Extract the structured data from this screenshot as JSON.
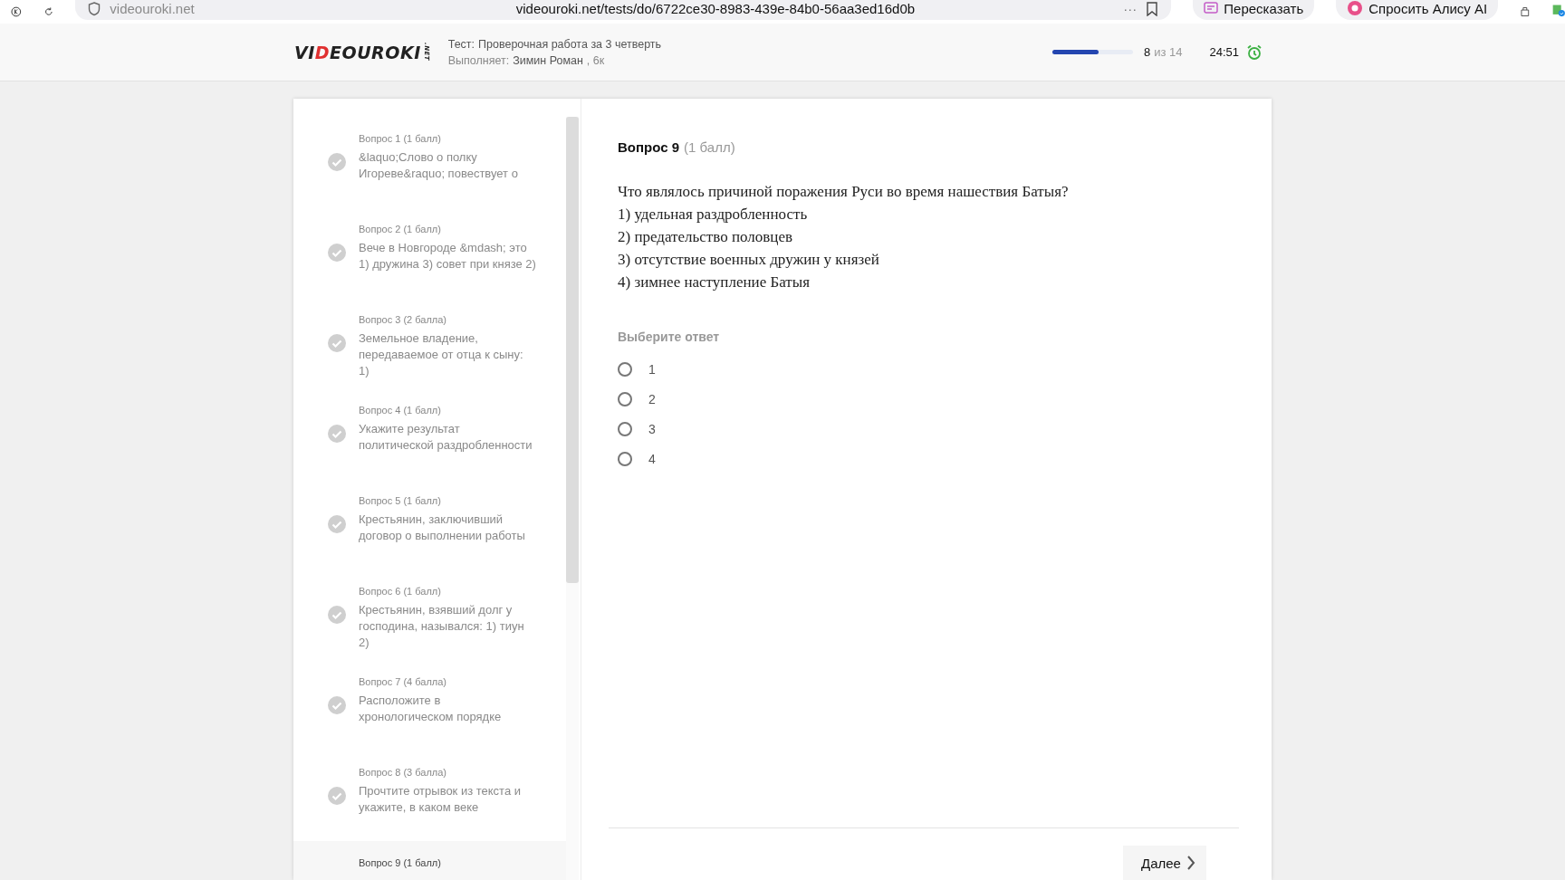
{
  "browser": {
    "site_label": "videouroki.net",
    "url": "videouroki.net/tests/do/6722ce30-8983-439e-84b0-56aa3ed16d0b",
    "more": "···",
    "buttons": [
      "Пересказать",
      "Спросить Алису AI"
    ]
  },
  "header": {
    "logo": {
      "prefix": "VI",
      "accent": "D",
      "rest": "EOUROKI",
      "suffix": ".NET"
    },
    "test_label": "Тест:",
    "test_name": "Проверочная работа за 3 четверть",
    "performer_label": "Выполняет:",
    "performer": "Зимин Роман",
    "group": ", 6к",
    "progress": {
      "level": 0.57,
      "current": "8",
      "total": "из 14"
    },
    "timer": "24:51"
  },
  "sidebar": {
    "items": [
      {
        "title": "Вопрос 1 (1 балл)",
        "excerpt": "&laquo;Слово о полку Игореве&raquo; повествует о",
        "answered": true,
        "selected": false
      },
      {
        "title": "Вопрос 2 (1 балл)",
        "excerpt": "Вече в Новгороде &mdash; это 1) дружина 3) совет при князе 2)",
        "answered": true,
        "selected": false
      },
      {
        "title": "Вопрос 3 (2 балла)",
        "excerpt": "Земельное владение, передаваемое от отца к сыну: 1)",
        "answered": true,
        "selected": false
      },
      {
        "title": "Вопрос 4 (1 балл)",
        "excerpt": "Укажите результат политической раздробленности",
        "answered": true,
        "selected": false
      },
      {
        "title": "Вопрос 5 (1 балл)",
        "excerpt": "Крестьянин, заключивший договор о выполнении работы",
        "answered": true,
        "selected": false
      },
      {
        "title": "Вопрос 6 (1 балл)",
        "excerpt": "Крестьянин, взявший долг у господина, назывался: 1) тиун 2)",
        "answered": true,
        "selected": false
      },
      {
        "title": "Вопрос 7 (4 балла)",
        "excerpt": "Расположите в хронологическом порядке",
        "answered": true,
        "selected": false
      },
      {
        "title": "Вопрос 8 (3 балла)",
        "excerpt": "Прочтите отрывок из текста и укажите, в каком веке",
        "answered": true,
        "selected": false
      },
      {
        "title": "Вопрос 9 (1 балл)",
        "answered": false,
        "selected": true
      }
    ]
  },
  "question": {
    "title": "Вопрос 9",
    "points": "(1 балл)",
    "lines": [
      "Что являлось причиной поражения Руси во время нашествия Батыя?",
      "1) удельная раздробленность",
      "2) предательство половцев",
      "3) отсутствие военных дружин у князей",
      "4) зимнее наступление Батыя"
    ],
    "prompt": "Выберите ответ",
    "options": [
      {
        "label": "1",
        "selected": false
      },
      {
        "label": "2",
        "selected": false
      },
      {
        "label": "3",
        "selected": false
      },
      {
        "label": "4",
        "selected": false
      }
    ],
    "next_button": "Далее"
  }
}
